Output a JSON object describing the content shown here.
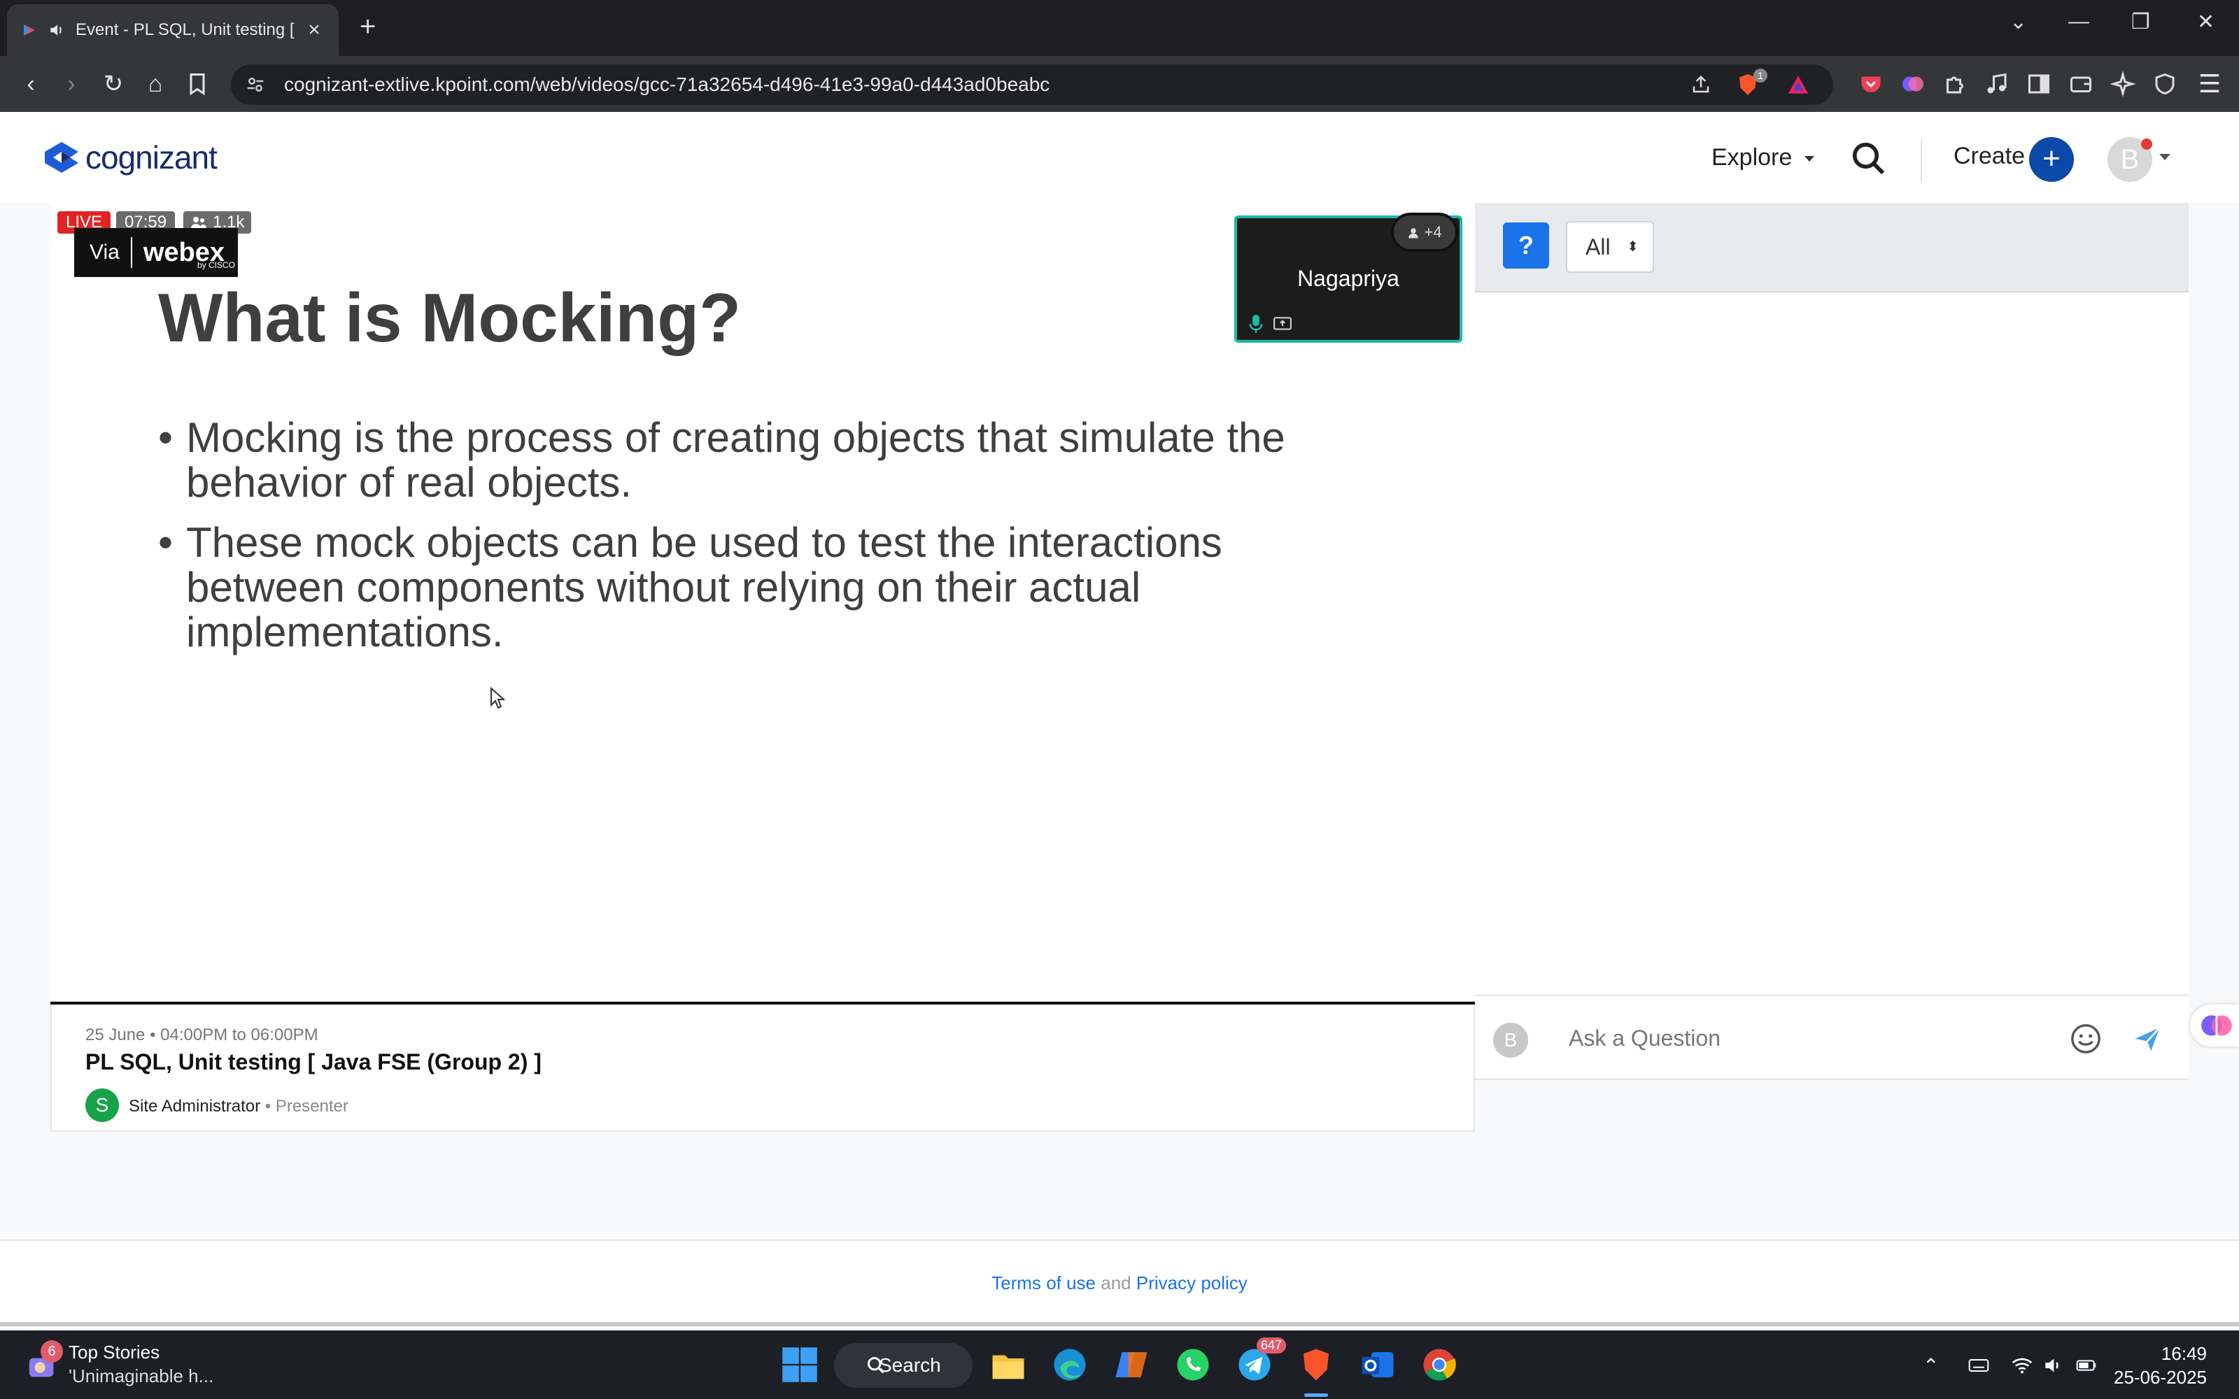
{
  "browser": {
    "tab_title": "Event - PL SQL, Unit testing [",
    "url": "cognizant-extlive.kpoint.com/web/videos/gcc-71a32654-d496-41e3-99a0-d443ad0beabc",
    "brave_badge": "1"
  },
  "header": {
    "logo_text": "cognizant",
    "explore_label": "Explore",
    "create_label": "Create",
    "avatar_initial": "B"
  },
  "video": {
    "live_label": "LIVE",
    "elapsed": "07:59",
    "viewers": "1.1k",
    "webex_via": "Via",
    "webex_brand": "webex",
    "webex_by": "by CISCO",
    "slide_title": "What is Mocking?",
    "bullets": [
      "Mocking is the process of creating objects that simulate the behavior of real objects.",
      "These mock objects can be used to test the interactions between components without relying on their actual implementations."
    ],
    "speaker_name": "Nagapriya",
    "extra_participants": "+4"
  },
  "event": {
    "date": "25 June • 04:00PM to 06:00PM",
    "title": "PL SQL, Unit testing [ Java FSE (Group 2) ]",
    "presenter_initial": "S",
    "presenter_name": "Site Administrator",
    "presenter_role": "• Presenter"
  },
  "qa": {
    "help_label": "?",
    "filter_value": "All",
    "avatar_initial": "B",
    "input_placeholder": "Ask a Question"
  },
  "footer": {
    "terms_label": "Terms of use",
    "and_text": "and",
    "privacy_label": "Privacy policy"
  },
  "taskbar": {
    "news_badge": "6",
    "news_title": "Top Stories",
    "news_sub": "'Unimaginable h...",
    "search_label": "Search",
    "telegram_badge": "647",
    "time": "16:49",
    "date": "25-06-2025"
  },
  "colors": {
    "accent_blue": "#0b4aa8",
    "live_red": "#e02424",
    "speaker_border": "#1db9a4"
  }
}
